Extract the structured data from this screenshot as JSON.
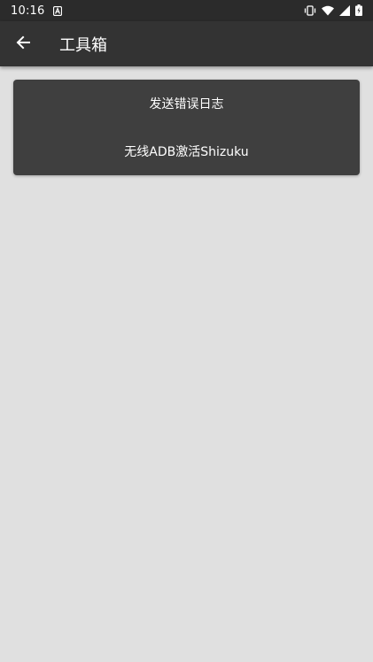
{
  "status_bar": {
    "time": "10:16",
    "icons": [
      "a-notification-icon",
      "vibrate-icon",
      "wifi-icon",
      "signal-icon",
      "battery-charging-icon"
    ]
  },
  "app_bar": {
    "back_icon": "arrow-left-icon",
    "title": "工具箱"
  },
  "menu": {
    "items": [
      {
        "label": "发送错误日志"
      },
      {
        "label": "无线ADB激活Shizuku"
      }
    ]
  },
  "colors": {
    "status_bar": "#2b2b2b",
    "app_bar": "#333333",
    "card": "#3f3f3f",
    "background": "#e0e0e0",
    "text": "#ffffff"
  }
}
